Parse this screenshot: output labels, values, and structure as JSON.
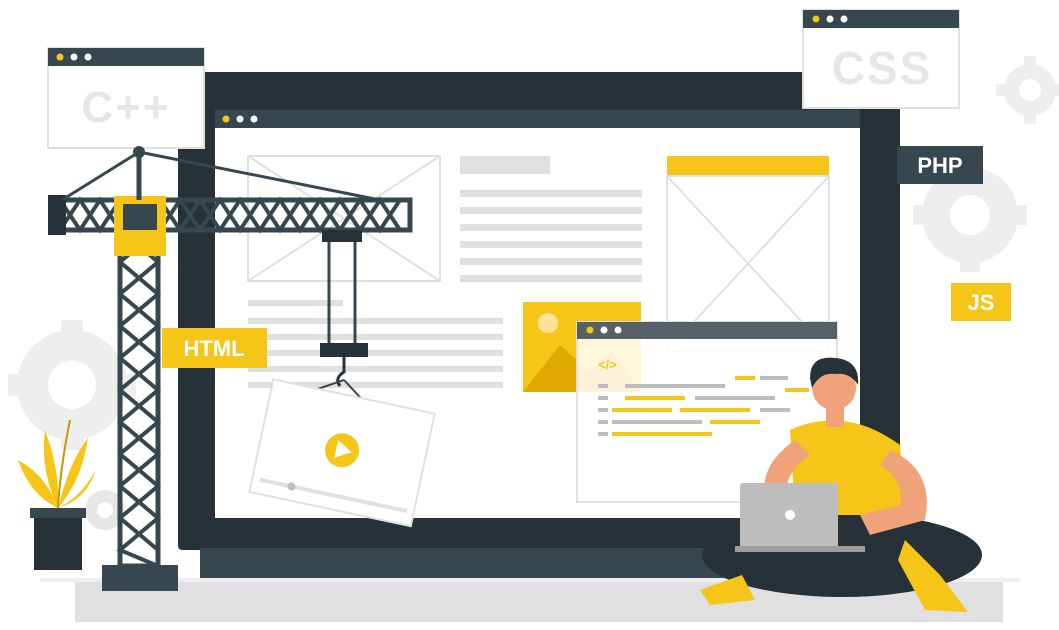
{
  "labels": {
    "cpp": "C++",
    "css": "CSS",
    "php": "PHP",
    "html": "HTML",
    "js": "JS",
    "code_tag": "</>"
  },
  "colors": {
    "dark": "#263238",
    "accent": "#f5c518",
    "accent_light": "#fbe49a",
    "light_gray": "#e0e0e0",
    "mid_gray": "#bdbdbd",
    "screen_white": "#ffffff",
    "skin": "#f0a27a"
  },
  "icons": [
    "gear-icon",
    "play-icon",
    "code-icon",
    "image-icon",
    "plant-icon",
    "crane-icon",
    "laptop-icon"
  ]
}
